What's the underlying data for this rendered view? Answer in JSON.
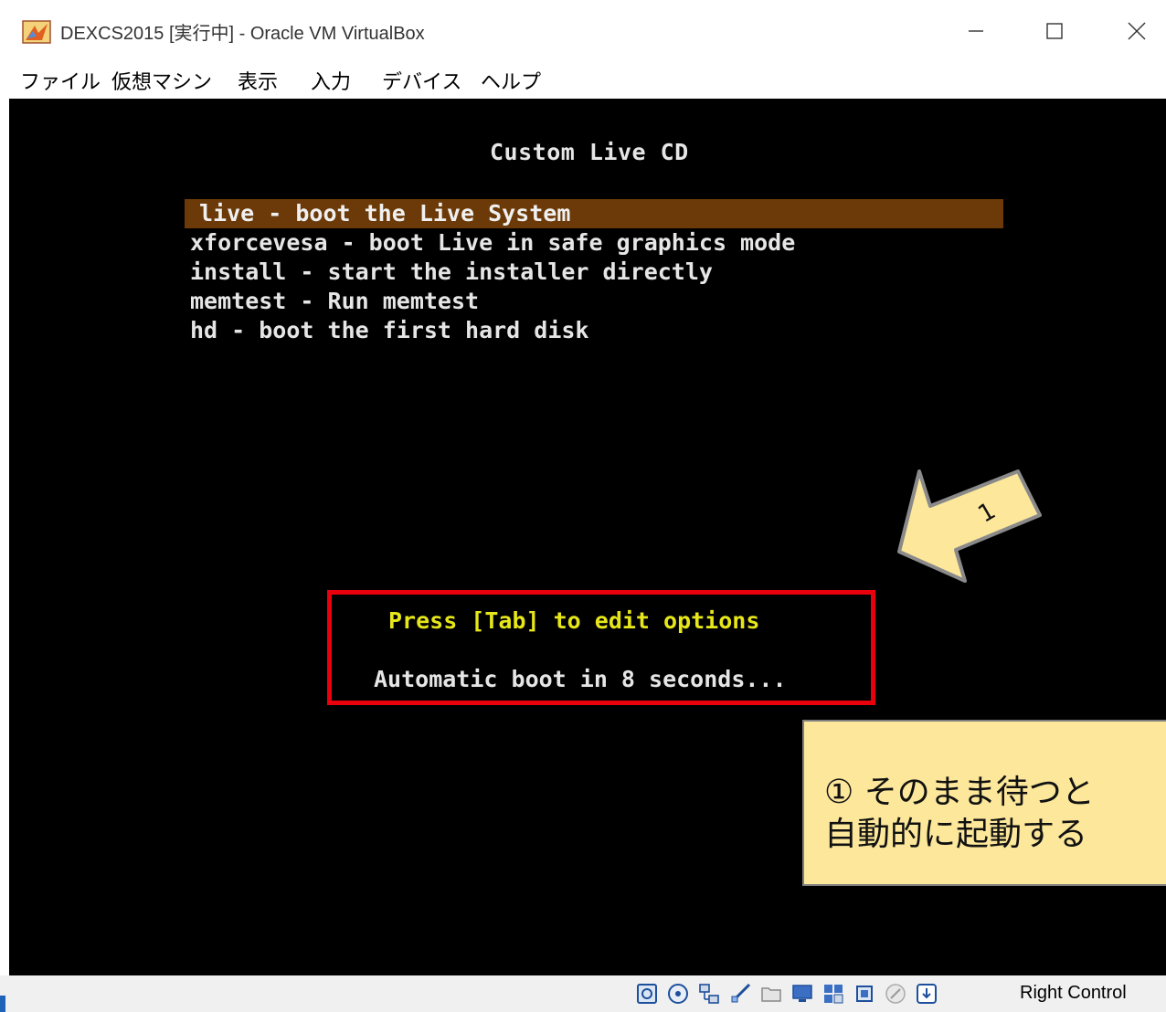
{
  "window": {
    "title": "DEXCS2015 [実行中] - Oracle VM VirtualBox",
    "app_icon": "virtualbox-icon",
    "controls": [
      "minimize-icon",
      "maximize-icon",
      "close-icon"
    ]
  },
  "menubar": {
    "items": [
      {
        "label": "ファイル"
      },
      {
        "label": "仮想マシン"
      },
      {
        "label": "表示"
      },
      {
        "label": "入力"
      },
      {
        "label": "デバイス"
      },
      {
        "label": "ヘルプ"
      }
    ]
  },
  "boot_menu": {
    "title": "Custom Live CD",
    "items": [
      {
        "label": "live - boot the Live System",
        "selected": true
      },
      {
        "label": "xforcevesa - boot Live in safe graphics mode",
        "selected": false
      },
      {
        "label": "install - start the installer directly",
        "selected": false
      },
      {
        "label": "memtest - Run memtest",
        "selected": false
      },
      {
        "label": "hd - boot the first hard disk",
        "selected": false
      }
    ],
    "hint": "Press [Tab] to edit options",
    "countdown": "Automatic boot in 8 seconds..."
  },
  "annotation": {
    "arrow_label": "1",
    "callout_line1": "① そのまま待つと",
    "callout_line2": "自動的に起動する",
    "highlight_color": "#e8000c",
    "callout_color": "#fce79a"
  },
  "statusbar": {
    "icons": [
      "hard-disk-icon",
      "optical-drive-icon",
      "network-icon",
      "usb-icon",
      "shared-folder-icon",
      "display-icon",
      "video-capture-icon",
      "cpu-icon",
      "mouse-integration-icon",
      "keyboard-capture-icon"
    ],
    "host_key": "Right Control"
  },
  "colors": {
    "selection_bg": "#6b3a08",
    "hint_text": "#e6e61a",
    "boot_text": "#e6e6e6"
  }
}
